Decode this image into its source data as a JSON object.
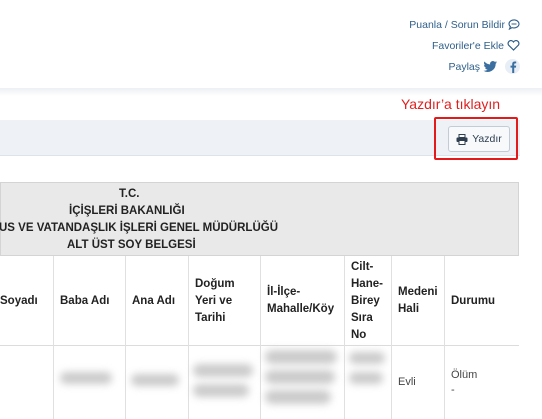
{
  "top_links": {
    "rate_label": "Puanla / Sorun Bildir",
    "favorites_label": "Favoriler'e Ekle",
    "share_label": "Paylaş"
  },
  "annotation": "Yazdır’a tıklayın",
  "toolbar": {
    "print_label": "Yazdır"
  },
  "document": {
    "header_lines": [
      "T.C.",
      "İÇİŞLERİ BAKANLIĞI",
      "US VE VATANDAŞLIK İŞLERİ GENEL MÜDÜRLÜĞÜ",
      "ALT ÜST SOY BELGESİ"
    ],
    "columns": [
      "Soyadı",
      "Baba Adı",
      "Ana Adı",
      "Doğum Yeri ve Tarihi",
      "İl-İlçe-Mahalle/Köy",
      "Cilt-Hane-Birey Sıra No",
      "Medeni Hali",
      "Durumu"
    ],
    "row": {
      "marital_status": "Evli",
      "status_line1": "Ölüm",
      "status_line2": "-"
    }
  },
  "colors": {
    "link": "#2f5f8a",
    "annotation_red": "#e02020",
    "toolbar_bg": "#eef1f5",
    "header_bg": "#e9e9e9"
  },
  "icons": {
    "rate": "comment-icon",
    "favorites": "heart-icon",
    "share_twitter": "twitter-icon",
    "share_facebook": "facebook-icon",
    "print": "printer-icon"
  }
}
